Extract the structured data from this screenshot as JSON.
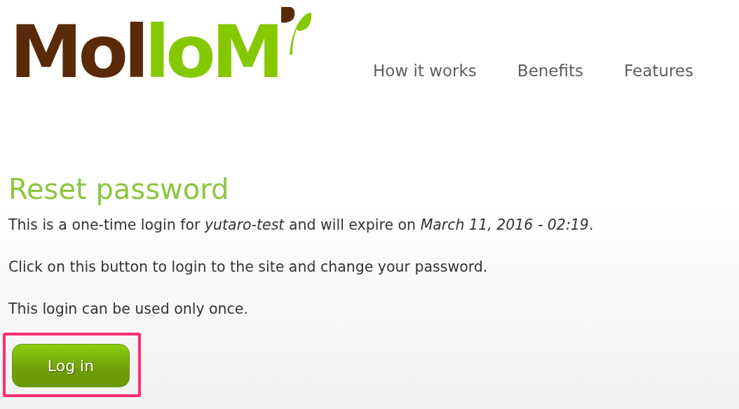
{
  "logo": {
    "dark_part": "Mol",
    "green_part": "loM"
  },
  "nav": [
    {
      "label": "How it works"
    },
    {
      "label": "Benefits"
    },
    {
      "label": "Features"
    }
  ],
  "heading": "Reset password",
  "paragraphs": [
    "This is a one-time login for *yutaro-test* and will expire on *March 11, 2016 - 02:19*.",
    "Click on this button to login to the site and change your password.",
    "This login can be used only once."
  ],
  "button": {
    "label": "Log in",
    "highlighted": true
  }
}
